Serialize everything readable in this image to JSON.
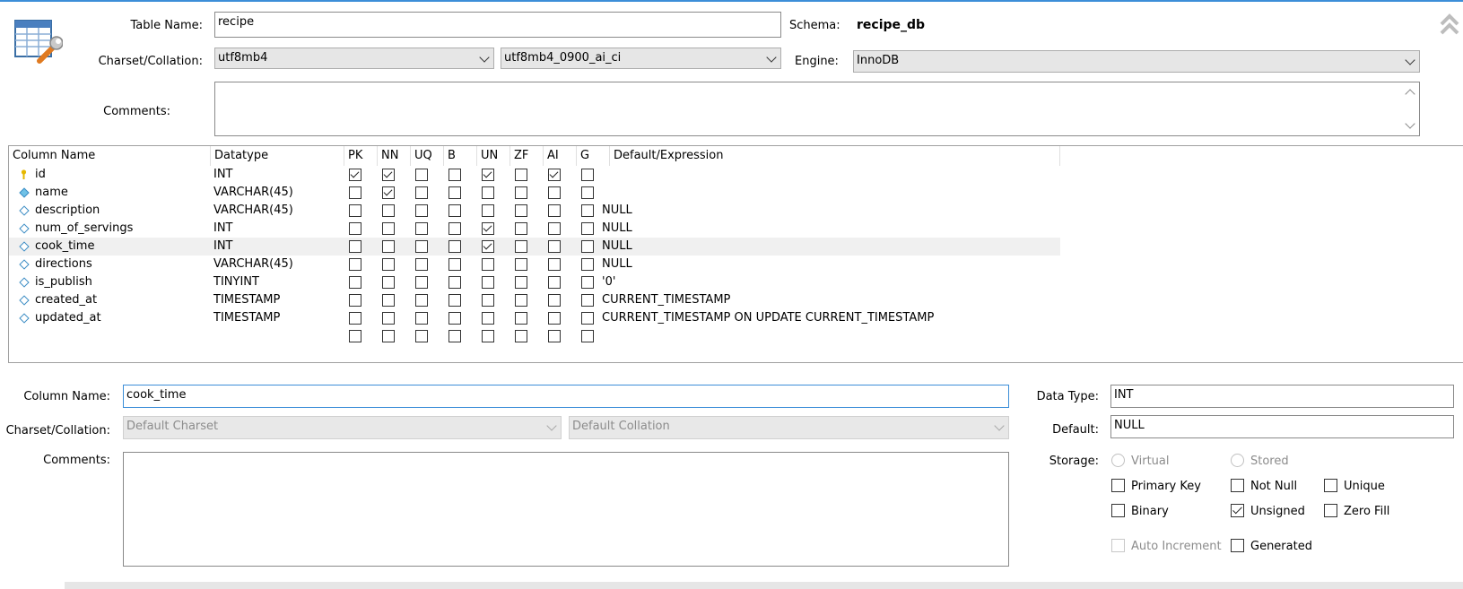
{
  "table": {
    "name_label": "Table Name:",
    "name_value": "recipe",
    "schema_label": "Schema:",
    "schema_value": "recipe_db",
    "charset_label": "Charset/Collation:",
    "charset_value": "utf8mb4",
    "collation_value": "utf8mb4_0900_ai_ci",
    "engine_label": "Engine:",
    "engine_value": "InnoDB",
    "comments_label": "Comments:"
  },
  "grid": {
    "headers": [
      "Column Name",
      "Datatype",
      "PK",
      "NN",
      "UQ",
      "B",
      "UN",
      "ZF",
      "AI",
      "G",
      "Default/Expression"
    ],
    "rows": [
      {
        "name": "id",
        "type": "INT",
        "flags": [
          true,
          true,
          false,
          false,
          true,
          false,
          true,
          false
        ],
        "default": "",
        "key": true
      },
      {
        "name": "name",
        "type": "VARCHAR(45)",
        "flags": [
          false,
          true,
          false,
          false,
          false,
          false,
          false,
          false
        ],
        "default": "",
        "filled": true
      },
      {
        "name": "description",
        "type": "VARCHAR(45)",
        "flags": [
          false,
          false,
          false,
          false,
          false,
          false,
          false,
          false
        ],
        "default": "NULL"
      },
      {
        "name": "num_of_servings",
        "type": "INT",
        "flags": [
          false,
          false,
          false,
          false,
          true,
          false,
          false,
          false
        ],
        "default": "NULL"
      },
      {
        "name": "cook_time",
        "type": "INT",
        "flags": [
          false,
          false,
          false,
          false,
          true,
          false,
          false,
          false
        ],
        "default": "NULL",
        "selected": true
      },
      {
        "name": "directions",
        "type": "VARCHAR(45)",
        "flags": [
          false,
          false,
          false,
          false,
          false,
          false,
          false,
          false
        ],
        "default": "NULL"
      },
      {
        "name": "is_publish",
        "type": "TINYINT",
        "flags": [
          false,
          false,
          false,
          false,
          false,
          false,
          false,
          false
        ],
        "default": "'0'"
      },
      {
        "name": "created_at",
        "type": "TIMESTAMP",
        "flags": [
          false,
          false,
          false,
          false,
          false,
          false,
          false,
          false
        ],
        "default": "CURRENT_TIMESTAMP"
      },
      {
        "name": "updated_at",
        "type": "TIMESTAMP",
        "flags": [
          false,
          false,
          false,
          false,
          false,
          false,
          false,
          false
        ],
        "default": "CURRENT_TIMESTAMP ON UPDATE CURRENT_TIMESTAMP"
      }
    ],
    "new_row_flags": [
      false,
      false,
      false,
      false,
      false,
      false,
      false,
      false
    ]
  },
  "details": {
    "column_name_label": "Column Name:",
    "column_name_value": "cook_time",
    "charset_label": "Charset/Collation:",
    "charset_placeholder": "Default Charset",
    "collation_placeholder": "Default Collation",
    "comments_label": "Comments:",
    "data_type_label": "Data Type:",
    "data_type_value": "INT",
    "default_label": "Default:",
    "default_value": "NULL",
    "storage_label": "Storage:",
    "virtual_label": "Virtual",
    "stored_label": "Stored",
    "primary_key_label": "Primary Key",
    "not_null_label": "Not Null",
    "unique_label": "Unique",
    "binary_label": "Binary",
    "unsigned_label": "Unsigned",
    "zero_fill_label": "Zero Fill",
    "auto_increment_label": "Auto Increment",
    "generated_label": "Generated",
    "checks": {
      "primary_key": false,
      "not_null": false,
      "unique": false,
      "binary": false,
      "unsigned": true,
      "zero_fill": false,
      "auto_increment": false,
      "generated": false
    }
  },
  "icons": {
    "table": "table-edit-icon",
    "collapse": "double-chevron-up-icon"
  },
  "colors": {
    "accent": "#3c8ed8",
    "diamond": "#3b8cc4",
    "key": "#e6b800"
  }
}
